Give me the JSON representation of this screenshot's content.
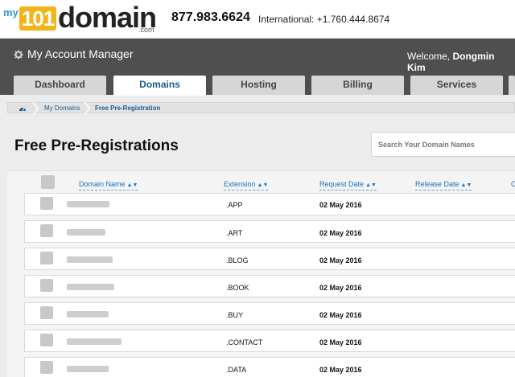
{
  "header": {
    "logo": {
      "my": "my",
      "num": "101",
      "word": "domain",
      "dotcom": ".com"
    },
    "phone": "877.983.6624",
    "international": "International: +1.760.444.8674"
  },
  "account": {
    "title": "My Account Manager",
    "welcome_prefix": "Welcome, ",
    "user_name": "Dongmin Kim"
  },
  "tabs": [
    {
      "label": "Dashboard",
      "active": false
    },
    {
      "label": "Domains",
      "active": true
    },
    {
      "label": "Hosting",
      "active": false
    },
    {
      "label": "Billing",
      "active": false
    },
    {
      "label": "Services",
      "active": false
    }
  ],
  "breadcrumb": {
    "items": [
      "My Domains",
      "Free Pre-Registration"
    ]
  },
  "page": {
    "title": "Free Pre-Registrations",
    "search_placeholder": "Search Your Domain Names"
  },
  "table": {
    "columns": [
      "Domain Name",
      "Extension",
      "Request Date",
      "Release Date"
    ],
    "cut_column": "C",
    "rows": [
      {
        "extension": ".APP",
        "request_date": "02 May 2016"
      },
      {
        "extension": ".ART",
        "request_date": "02 May 2016"
      },
      {
        "extension": ".BLOG",
        "request_date": "02 May 2016"
      },
      {
        "extension": ".BOOK",
        "request_date": "02 May 2016"
      },
      {
        "extension": ".BUY",
        "request_date": "02 May 2016"
      },
      {
        "extension": ".CONTACT",
        "request_date": "02 May 2016"
      },
      {
        "extension": ".DATA",
        "request_date": "02 May 2016"
      }
    ]
  },
  "colors": {
    "accent_blue": "#1a73c0",
    "logo_yellow": "#f2b519",
    "account_bar": "#4f4f4f"
  }
}
